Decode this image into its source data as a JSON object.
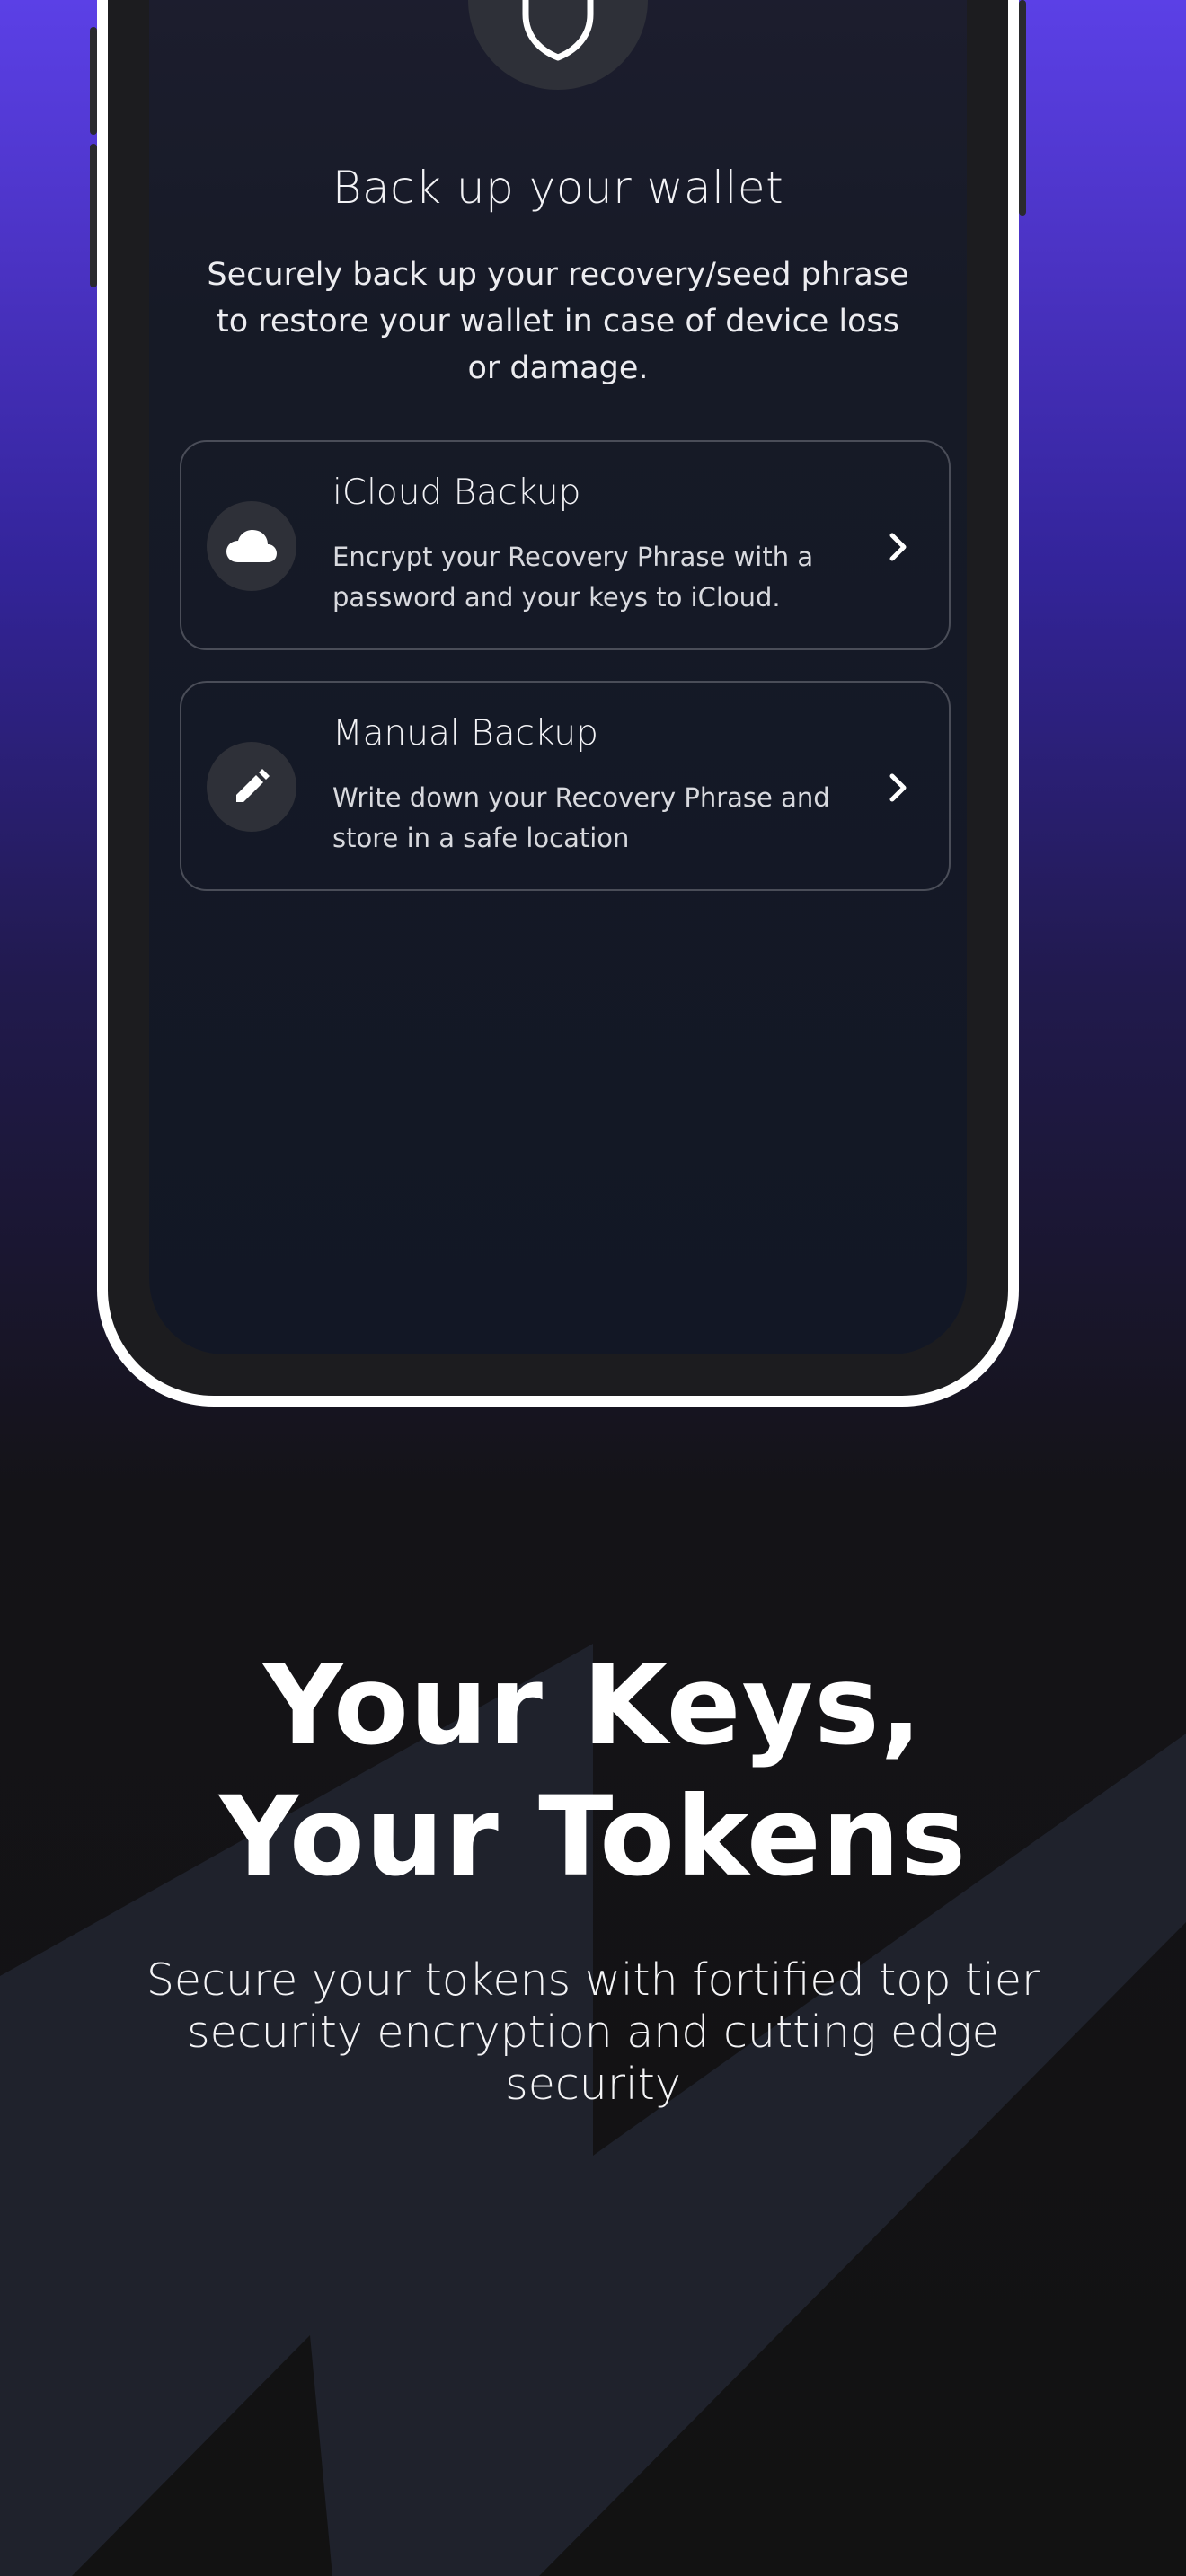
{
  "screen": {
    "title": "Back up your wallet",
    "description": "Securely back up your recovery/seed phrase to restore your wallet in case of device loss or damage."
  },
  "options": [
    {
      "title": "iCloud Backup",
      "description": "Encrypt your Recovery Phrase with a password and your keys to iCloud.",
      "icon": "cloud-icon"
    },
    {
      "title": "Manual Backup",
      "description": "Write down your Recovery Phrase and store in a safe location",
      "icon": "pencil-icon"
    }
  ],
  "marketing": {
    "headline_line1": "Your Keys,",
    "headline_line2": "Your Tokens",
    "subline": "Secure your tokens with fortified top tier security encryption and cutting edge security"
  },
  "colors": {
    "background_top": "#5b40e6",
    "background_bottom": "#121212",
    "screen_bg": "#131826",
    "card_border": "#4a4d58",
    "icon_circle": "#2e3038",
    "text": "#f2f2f5"
  }
}
